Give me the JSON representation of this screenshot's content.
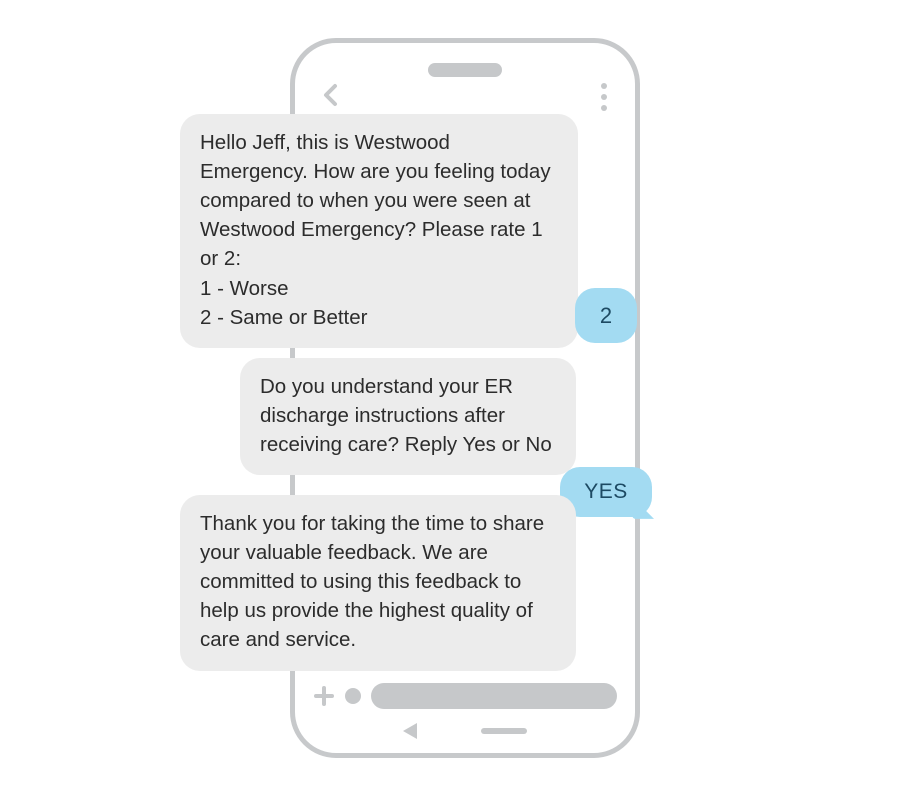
{
  "messages": {
    "m1": "Hello Jeff, this is Westwood Emergency. How are you feeling today compared to when you were seen at Westwood Emergency? Please rate 1 or 2:\n1 - Worse\n2 - Same or Better",
    "r1": "2",
    "m2": "Do you understand your ER discharge instructions after receiving care? Reply Yes or No",
    "r2": "YES",
    "m3": "Thank you for taking the time to share your valuable feedback. We are committed to using this feedback to help us provide the highest quality of care and service."
  }
}
